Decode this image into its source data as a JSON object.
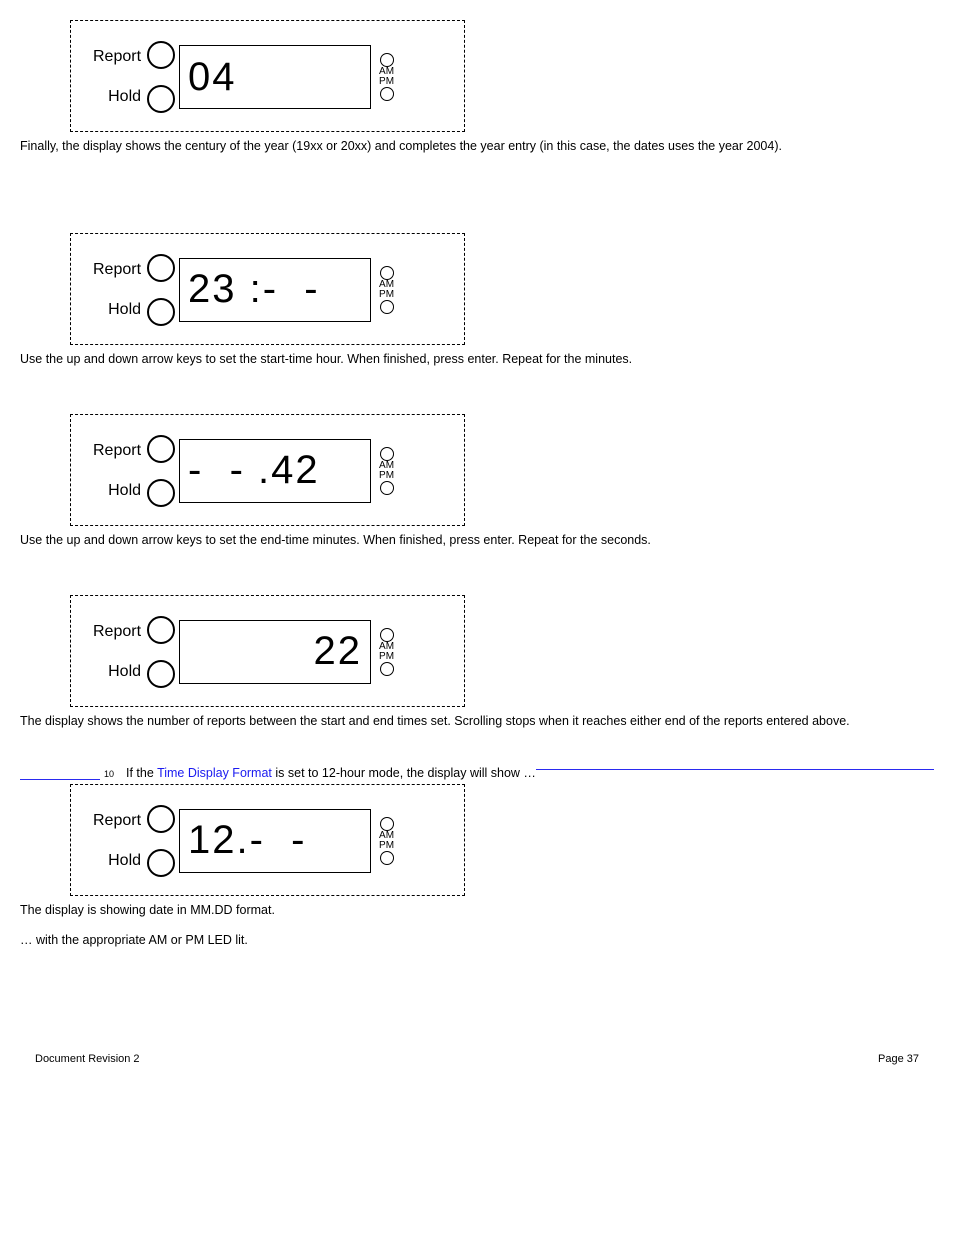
{
  "common": {
    "report_label": "Report",
    "hold_label": "Hold",
    "am_label": "AM",
    "pm_label": "PM"
  },
  "panels": [
    {
      "display": "04",
      "align": "left",
      "caption": "Finally, the display shows the century of the year (19xx or 20xx) and completes the year entry (in this case, the dates uses the year 2004)."
    },
    {
      "display": "23 :-  -",
      "align": "left",
      "caption": "Use the up and down arrow keys to set the start-time hour. When finished, press enter. Repeat for the minutes."
    },
    {
      "display": "-  - .42",
      "align": "left",
      "caption": "Use the up and down arrow keys to set the end-time minutes. When finished, press enter. Repeat for the seconds."
    },
    {
      "display": "22",
      "align": "right",
      "caption": "The display shows the number of reports between the start and end times set. Scrolling stops when it reaches either end of the reports entered above."
    },
    {
      "display": "12.-  -",
      "align": "left",
      "caption": "The display is showing date in MM.DD format."
    }
  ],
  "footnote": {
    "num": "10",
    "pre": " If the ",
    "link": "Time Display Format",
    "post": " is set to 12-hour mode, the display will show …"
  },
  "continuation": "… with the appropriate AM or PM LED lit.",
  "footer": {
    "left": "Document Revision 2",
    "right": "Page 37"
  }
}
